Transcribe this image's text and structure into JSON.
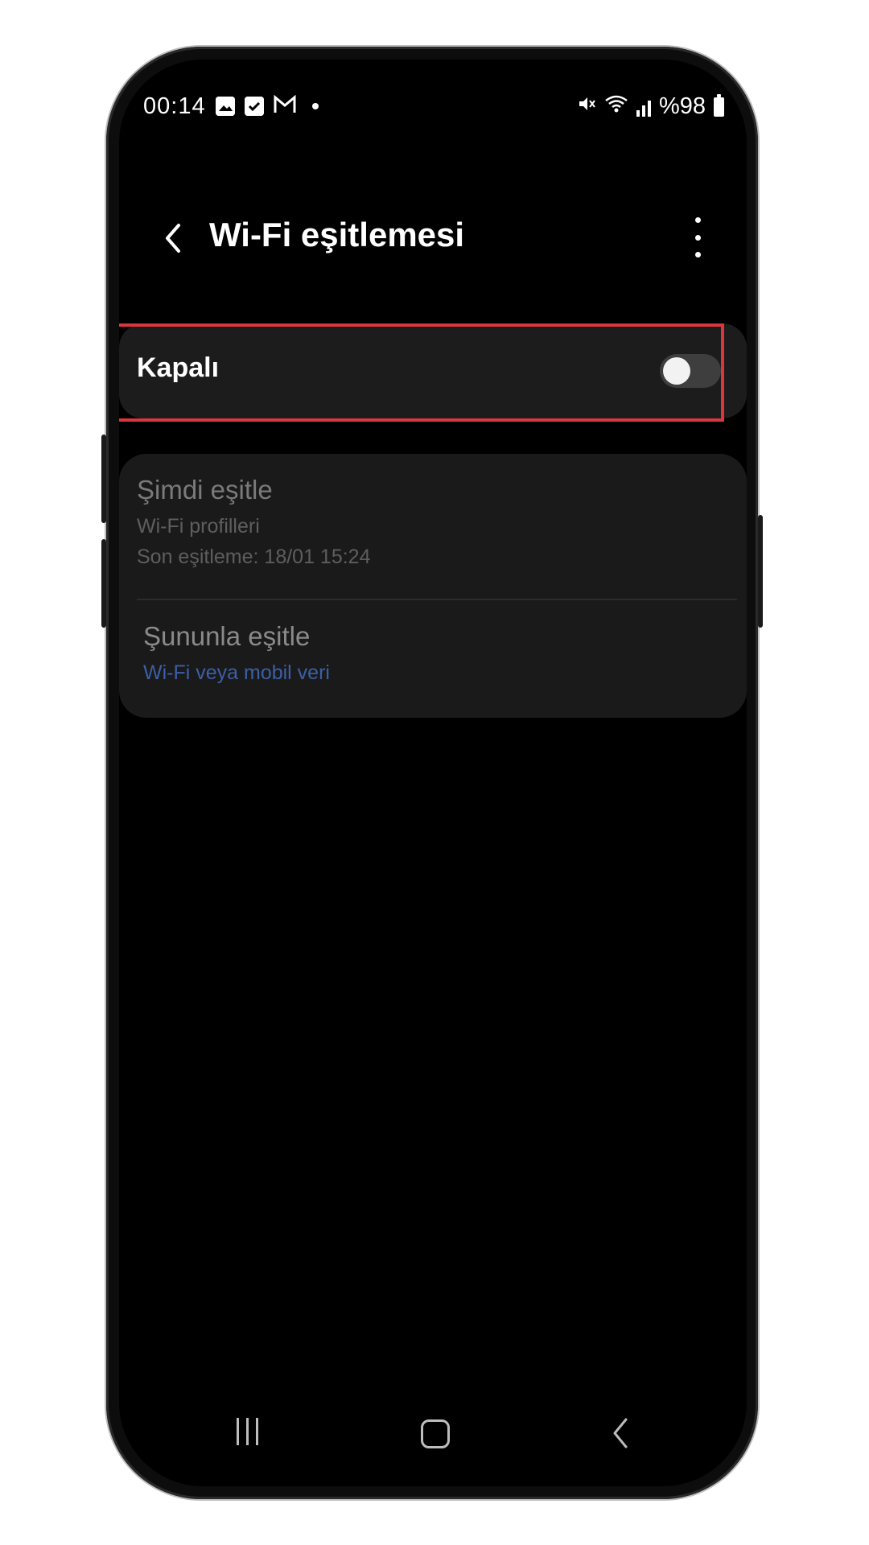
{
  "status_bar": {
    "time": "00:14",
    "battery_text": "%98",
    "icons_left": [
      "gallery-icon",
      "check-icon",
      "gmail-icon",
      "dot-icon"
    ],
    "icons_right": [
      "mute-icon",
      "wifi-icon",
      "signal-icon",
      "battery-icon"
    ]
  },
  "app_bar": {
    "title": "Wi-Fi eşitlemesi"
  },
  "master_toggle": {
    "label": "Kapalı",
    "state": "off"
  },
  "settings": {
    "sync_now": {
      "title": "Şimdi eşitle",
      "subtitle": "Wi-Fi profilleri",
      "last_sync": "Son eşitleme: 18/01 15:24"
    },
    "sync_with": {
      "title": "Şununla eşitle",
      "value": "Wi-Fi veya mobil veri"
    }
  },
  "colors": {
    "highlight": "#d9363e",
    "accent_link": "#3c5fa8",
    "card_background": "#1c1c1c",
    "screen_background": "#000000"
  }
}
